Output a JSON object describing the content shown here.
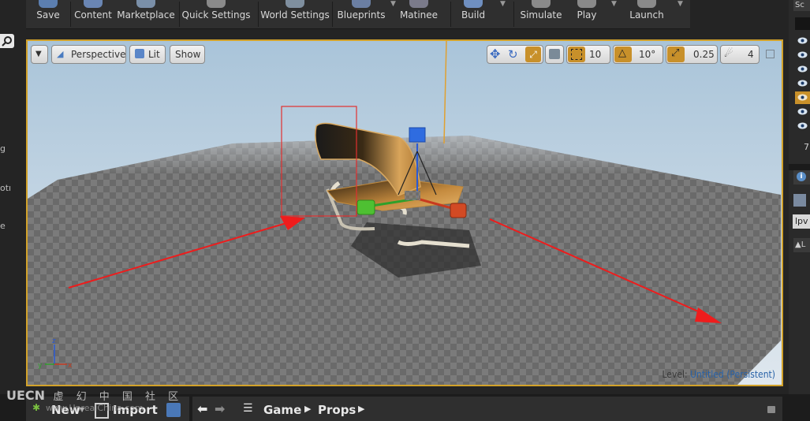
{
  "toolbar": {
    "items": [
      {
        "label": "Save"
      },
      {
        "label": "Content"
      },
      {
        "label": "Marketplace"
      },
      {
        "label": "Quick Settings"
      },
      {
        "label": "World Settings"
      },
      {
        "label": "Blueprints"
      },
      {
        "label": "Matinee"
      },
      {
        "label": "Build"
      },
      {
        "label": "Simulate"
      },
      {
        "label": "Play"
      },
      {
        "label": "Launch"
      }
    ],
    "accent_color": "#d2a22a"
  },
  "viewport": {
    "view_mode": "Perspective",
    "lighting_mode": "Lit",
    "show_label": "Show",
    "grid_snap": "10",
    "rotation_snap": "10°",
    "scale_snap": "0.25",
    "camera_speed": "4",
    "level_prefix": "Level:",
    "level_name": "Untitled (Persistent)"
  },
  "left_strip": {
    "fragments": [
      "g",
      "otı",
      "e"
    ]
  },
  "right_panel": {
    "top_text": "Sc",
    "count_text": "7",
    "field_text": "lpv",
    "row_text": "L"
  },
  "bottom": {
    "new_label": "New",
    "import_label": "Import",
    "path": [
      "Game",
      "Props"
    ],
    "watermark": "虚 幻 中 国 社 区",
    "watermark_sub": "www.UnrealChina.com"
  }
}
